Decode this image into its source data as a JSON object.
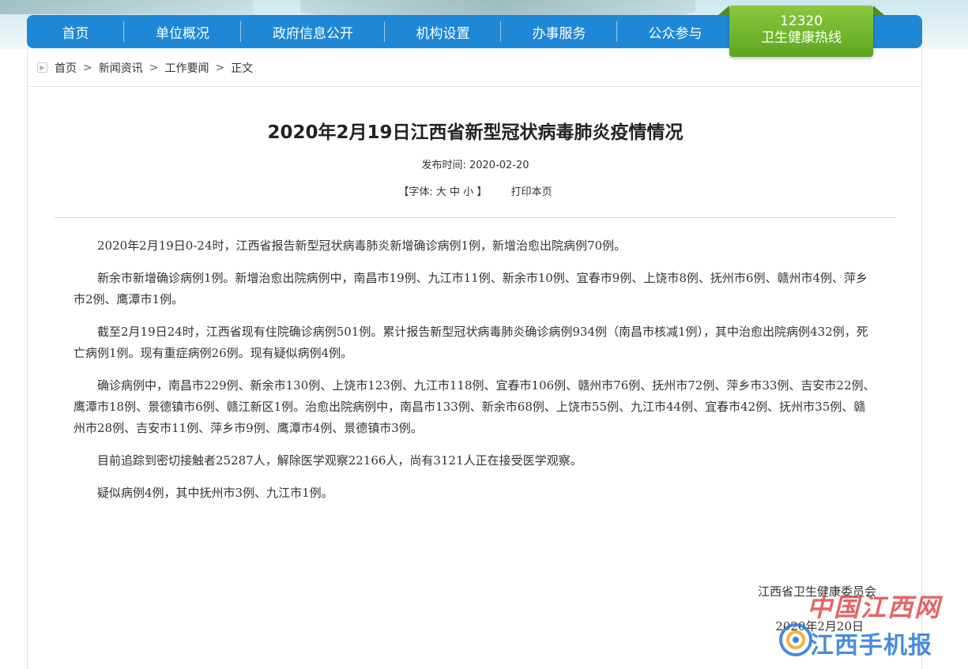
{
  "nav": {
    "items": [
      {
        "label": "首页"
      },
      {
        "label": "单位概况"
      },
      {
        "label": "政府信息公开"
      },
      {
        "label": "机构设置"
      },
      {
        "label": "办事服务"
      },
      {
        "label": "公众参与"
      }
    ],
    "hotline": {
      "number": "12320",
      "label": "卫生健康热线"
    }
  },
  "breadcrumb": {
    "items": [
      "首页",
      "新闻资讯",
      "工作要闻",
      "正文"
    ],
    "separator": ">"
  },
  "article": {
    "title": "2020年2月19日江西省新型冠状病毒肺炎疫情情况",
    "publish_label": "发布时间:",
    "publish_date": "2020-02-20",
    "font_label": "【字体:",
    "font_large": "大",
    "font_medium": "中",
    "font_small": "小",
    "font_close": "】",
    "print_label": "打印本页",
    "paragraphs": [
      "2020年2月19日0-24时，江西省报告新型冠状病毒肺炎新增确诊病例1例，新增治愈出院病例70例。",
      "新余市新增确诊病例1例。新增治愈出院病例中，南昌市19例、九江市11例、新余市10例、宜春市9例、上饶市8例、抚州市6例、赣州市4例、萍乡市2例、鹰潭市1例。",
      "截至2月19日24时，江西省现有住院确诊病例501例。累计报告新型冠状病毒肺炎确诊病例934例（南昌市核减1例），其中治愈出院病例432例，死亡病例1例。现有重症病例26例。现有疑似病例4例。",
      "确诊病例中，南昌市229例、新余市130例、上饶市123例、九江市118例、宜春市106例、赣州市76例、抚州市72例、萍乡市33例、吉安市22例、鹰潭市18例、景德镇市6例、赣江新区1例。治愈出院病例中，南昌市133例、新余市68例、上饶市55例、九江市44例、宜春市42例、抚州市35例、赣州市28例、吉安市11例、萍乡市9例、鹰潭市4例、景德镇市3例。",
      "目前追踪到密切接触者25287人，解除医学观察22166人，尚有3121人正在接受医学观察。",
      "疑似病例4例，其中抚州市3例、九江市1例。"
    ],
    "signature_org": "江西省卫生健康委员会",
    "signature_date": "2020年2月20日"
  },
  "watermark": {
    "top_text": "中国江西网",
    "bottom_text": "江西手机报",
    "colors": {
      "red": "#dc2828",
      "blue": "#2878d7"
    }
  },
  "colors": {
    "nav_bg": "#1f88d6",
    "hotline_bg": "#6fb52b",
    "text": "#333333"
  },
  "icons": {
    "breadcrumb_icon": "play-triangle-icon"
  }
}
